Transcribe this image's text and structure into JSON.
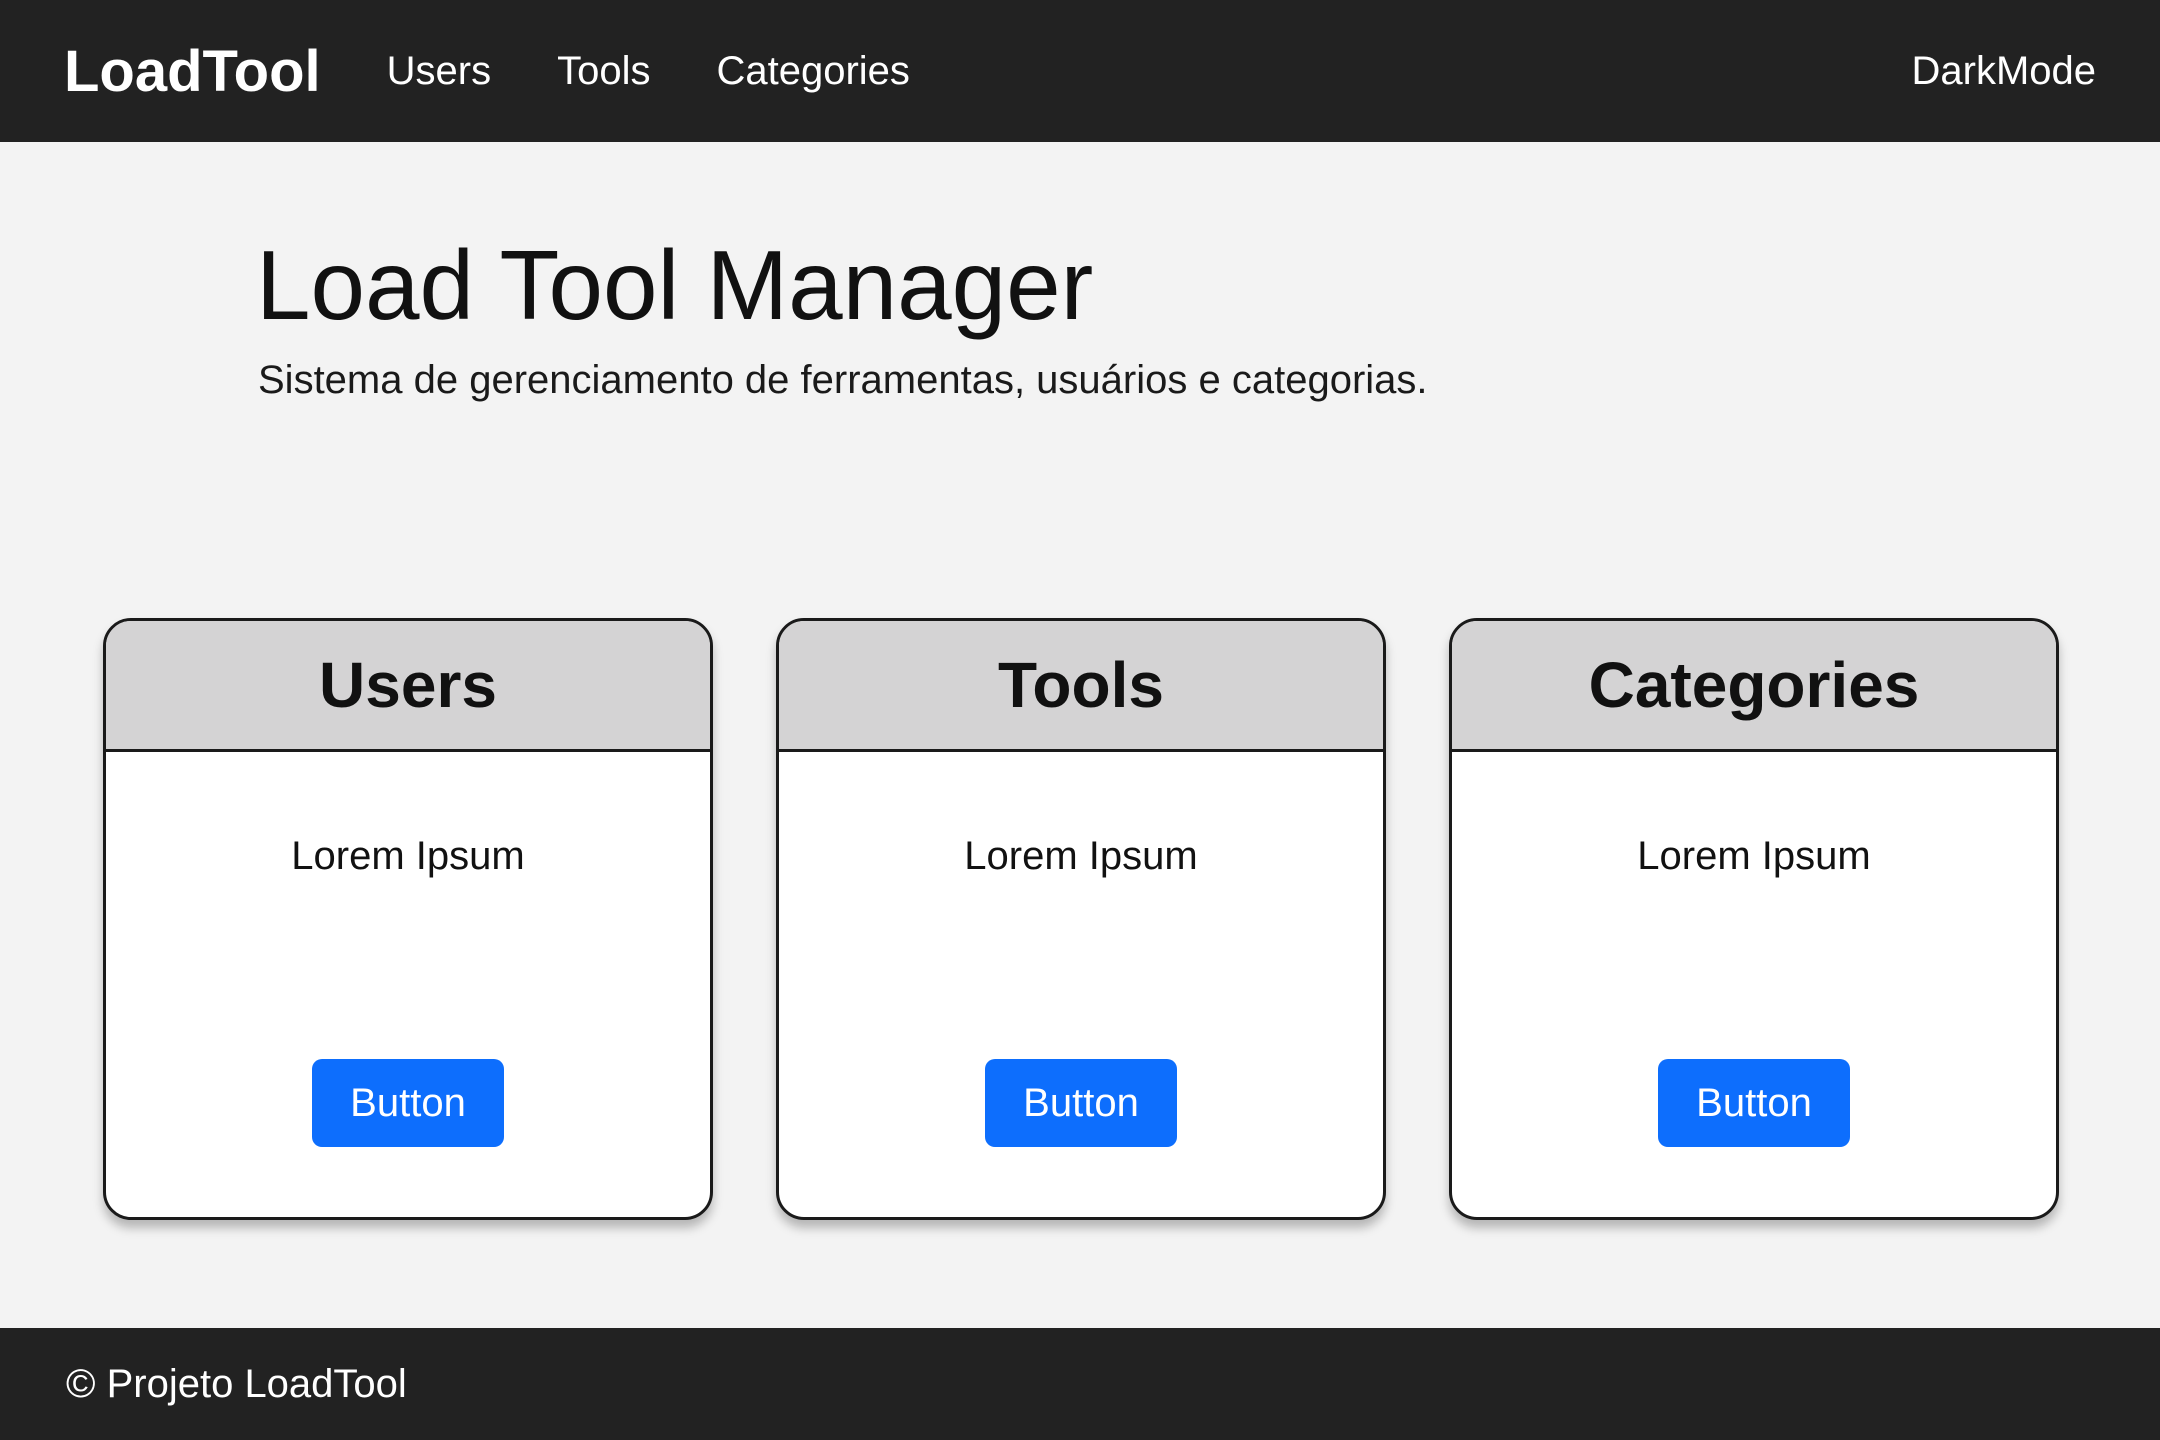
{
  "navbar": {
    "brand": "LoadTool",
    "links": [
      {
        "label": "Users"
      },
      {
        "label": "Tools"
      },
      {
        "label": "Categories"
      }
    ],
    "darkmode_label": "DarkMode"
  },
  "hero": {
    "title": "Load Tool Manager",
    "subtitle": "Sistema de gerenciamento de ferramentas, usuários e categorias."
  },
  "cards": [
    {
      "title": "Users",
      "text": "Lorem Ipsum",
      "button_label": "Button"
    },
    {
      "title": "Tools",
      "text": "Lorem Ipsum",
      "button_label": "Button"
    },
    {
      "title": "Categories",
      "text": "Lorem Ipsum",
      "button_label": "Button"
    }
  ],
  "footer": {
    "text": "© Projeto LoadTool"
  },
  "colors": {
    "navbar_bg": "#222222",
    "page_bg": "#f3f3f3",
    "card_header_bg": "#d4d3d4",
    "button_bg": "#0d6efd"
  }
}
